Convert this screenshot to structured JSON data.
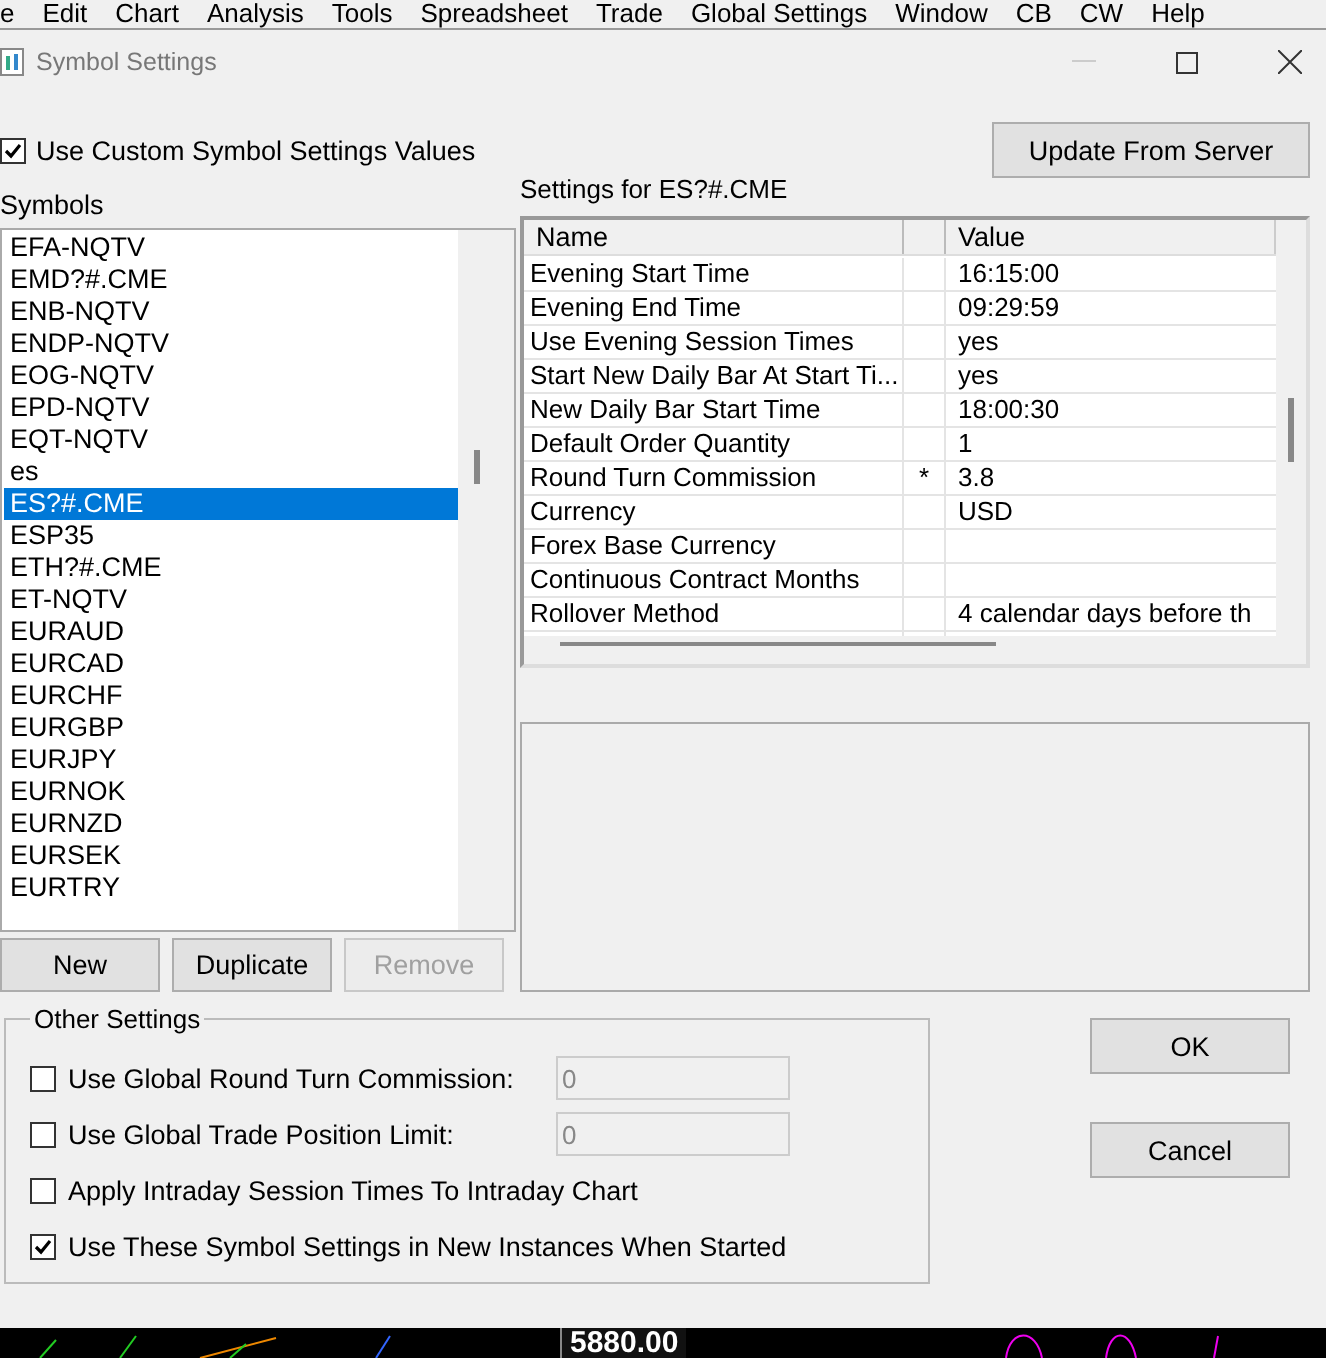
{
  "menu": [
    "e",
    "Edit",
    "Chart",
    "Analysis",
    "Tools",
    "Spreadsheet",
    "Trade",
    "Global Settings",
    "Window",
    "CB",
    "CW",
    "Help"
  ],
  "window": {
    "title": "Symbol Settings"
  },
  "use_custom": {
    "label": "Use Custom Symbol Settings Values",
    "checked": true
  },
  "update_button": "Update From Server",
  "symbols": {
    "label": "Symbols",
    "items": [
      {
        "label": "EFA-NQTV",
        "selected": false
      },
      {
        "label": "EMD?#.CME",
        "selected": false
      },
      {
        "label": "ENB-NQTV",
        "selected": false
      },
      {
        "label": "ENDP-NQTV",
        "selected": false
      },
      {
        "label": "EOG-NQTV",
        "selected": false
      },
      {
        "label": "EPD-NQTV",
        "selected": false
      },
      {
        "label": "EQT-NQTV",
        "selected": false
      },
      {
        "label": "es",
        "selected": false
      },
      {
        "label": "ES?#.CME",
        "selected": true
      },
      {
        "label": "ESP35",
        "selected": false
      },
      {
        "label": "ETH?#.CME",
        "selected": false
      },
      {
        "label": "ET-NQTV",
        "selected": false
      },
      {
        "label": "EURAUD",
        "selected": false
      },
      {
        "label": "EURCAD",
        "selected": false
      },
      {
        "label": "EURCHF",
        "selected": false
      },
      {
        "label": "EURGBP",
        "selected": false
      },
      {
        "label": "EURJPY",
        "selected": false
      },
      {
        "label": "EURNOK",
        "selected": false
      },
      {
        "label": "EURNZD",
        "selected": false
      },
      {
        "label": "EURSEK",
        "selected": false
      },
      {
        "label": "EURTRY",
        "selected": false
      }
    ]
  },
  "list_buttons": [
    {
      "label": "New",
      "disabled": false
    },
    {
      "label": "Duplicate",
      "disabled": false
    },
    {
      "label": "Remove",
      "disabled": true
    }
  ],
  "settings": {
    "title": "Settings for ES?#.CME",
    "columns": [
      "Name",
      "Value"
    ],
    "rows": [
      {
        "name": "Evening Start Time",
        "flag": "",
        "value": "16:15:00"
      },
      {
        "name": "Evening End Time",
        "flag": "",
        "value": "09:29:59"
      },
      {
        "name": "Use Evening Session Times",
        "flag": "",
        "value": "yes"
      },
      {
        "name": "Start New Daily Bar At Start Ti...",
        "flag": "",
        "value": "yes"
      },
      {
        "name": "New Daily Bar Start Time",
        "flag": "",
        "value": "18:00:30"
      },
      {
        "name": "Default Order Quantity",
        "flag": "",
        "value": "1"
      },
      {
        "name": "Round Turn Commission",
        "flag": "*",
        "value": "3.8"
      },
      {
        "name": "Currency",
        "flag": "",
        "value": "USD"
      },
      {
        "name": "Forex Base Currency",
        "flag": "",
        "value": ""
      },
      {
        "name": "Continuous Contract Months",
        "flag": "",
        "value": ""
      },
      {
        "name": "Rollover Method",
        "flag": "",
        "value": "4 calendar days before th"
      }
    ]
  },
  "other_settings": {
    "title": "Other Settings",
    "options": [
      {
        "label": "Use Global Round Turn Commission:",
        "checked": false,
        "field": "0"
      },
      {
        "label": "Use Global Trade Position Limit:",
        "checked": false,
        "field": "0"
      },
      {
        "label": "Apply Intraday Session Times To Intraday Chart",
        "checked": false
      },
      {
        "label": "Use These Symbol Settings in New Instances When Started",
        "checked": true
      }
    ]
  },
  "dialog_buttons": [
    "OK",
    "Cancel"
  ],
  "chart_strip": {
    "price": "5880.00"
  }
}
